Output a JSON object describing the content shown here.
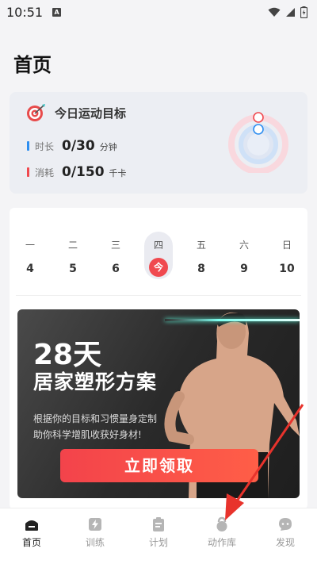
{
  "status": {
    "time": "10:51",
    "notification": "A"
  },
  "page": {
    "title": "首页"
  },
  "goal": {
    "title": "今日运动目标",
    "duration": {
      "label": "时长",
      "value": "0/30",
      "unit": "分钟",
      "color": "#2e8ef0"
    },
    "calories": {
      "label": "消耗",
      "value": "0/150",
      "unit": "千卡",
      "color": "#f0494f"
    }
  },
  "week": [
    {
      "name": "一",
      "num": "4",
      "today": false
    },
    {
      "name": "二",
      "num": "5",
      "today": false
    },
    {
      "name": "三",
      "num": "6",
      "today": false
    },
    {
      "name": "四",
      "num": "今",
      "today": true
    },
    {
      "name": "五",
      "num": "8",
      "today": false
    },
    {
      "name": "六",
      "num": "9",
      "today": false
    },
    {
      "name": "日",
      "num": "10",
      "today": false
    }
  ],
  "banner": {
    "title1": "28天",
    "title2": "居家塑形方案",
    "desc_line1": "根据你的目标和习惯量身定制",
    "desc_line2": "助你科学增肌收获好身材!",
    "cta": "立即领取"
  },
  "tabs": [
    {
      "label": "首页",
      "icon": "home-icon",
      "active": true
    },
    {
      "label": "训练",
      "icon": "lightning-icon",
      "active": false
    },
    {
      "label": "计划",
      "icon": "clipboard-icon",
      "active": false
    },
    {
      "label": "动作库",
      "icon": "kettlebell-icon",
      "active": false
    },
    {
      "label": "发现",
      "icon": "chat-icon",
      "active": false
    }
  ],
  "colors": {
    "accent": "#f0494f",
    "blue": "#2e8ef0"
  }
}
